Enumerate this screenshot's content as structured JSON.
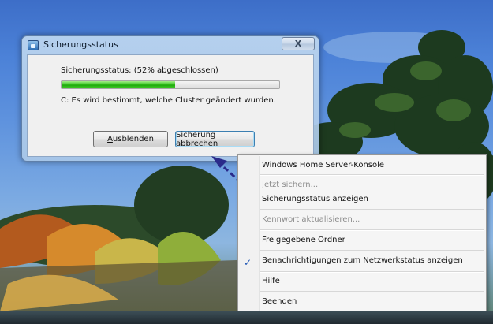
{
  "dialog": {
    "title": "Sicherungsstatus",
    "close_symbol": "X",
    "status_text": "Sicherungsstatus: (52% abgeschlossen)",
    "progress_fraction": 0.52,
    "detail_text": "C: Es wird bestimmt, welche Cluster geändert wurden.",
    "hide_button_mnemonic": "A",
    "hide_button_rest": "usblenden",
    "cancel_button": "Sicherung abbrechen"
  },
  "context_menu": {
    "items": [
      {
        "label": "Windows Home Server-Konsole",
        "enabled": true
      },
      {
        "label": "Jetzt sichern...",
        "enabled": false
      },
      {
        "label": "Sicherungsstatus anzeigen",
        "enabled": true
      },
      {
        "label": "Kennwort aktualisieren...",
        "enabled": false
      },
      {
        "label": "Freigegebene Ordner",
        "enabled": true
      },
      {
        "label": "Benachrichtigungen zum Netzwerkstatus anzeigen",
        "enabled": true,
        "checked": true
      },
      {
        "label": "Hilfe",
        "enabled": true
      },
      {
        "label": "Beenden",
        "enabled": true
      }
    ],
    "check_symbol": "✓"
  },
  "colors": {
    "progress_green": "#2fbf1c",
    "arrow": "#2a2a8a",
    "check": "#2359b5"
  }
}
